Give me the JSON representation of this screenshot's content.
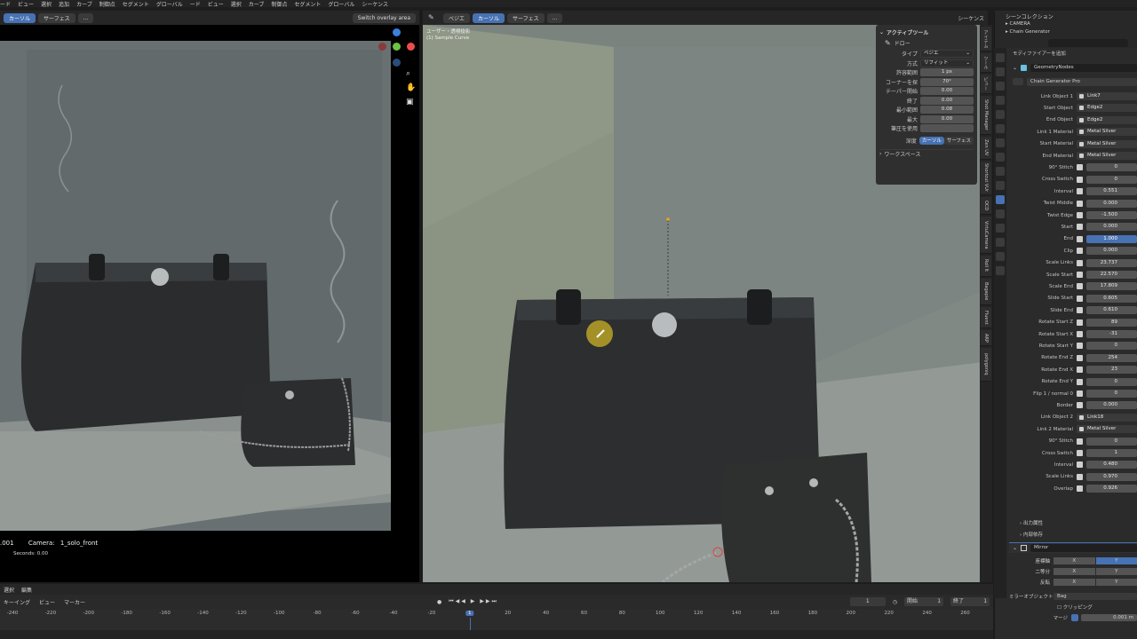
{
  "topbar": {
    "menus": [
      "ード",
      "ビュー",
      "選択",
      "追加",
      "カーブ",
      "制御点",
      "セグメント",
      "グローバル",
      "ード",
      "ビュー",
      "選択",
      "カーブ",
      "制御点",
      "セグメント",
      "グローバル",
      "シーケンス"
    ]
  },
  "left_header": {
    "mode_cursor": "カーソル",
    "mode_surface": "サーフェス",
    "more": "...",
    "overlay_button": "Switch overlay area"
  },
  "left_viewport": {
    "frame_text": ".001",
    "camera_label": "Camera:",
    "camera_name": "1_solo_front",
    "seconds": "Seconds: 0.00"
  },
  "right_header": {
    "curve_type": "ベジエ",
    "mode_cursor": "カーソル",
    "mode_surface": "サーフェス",
    "more": "...",
    "sequence": "シーケンス"
  },
  "right_viewport": {
    "view_name": "ユーザー・透視投影",
    "object_name": "(1) Sample Curve"
  },
  "tool_panel": {
    "title": "アクティブツール",
    "tool": "ドロー",
    "rows": [
      {
        "label": "タイプ",
        "value": "ベジエ",
        "kind": "drop"
      },
      {
        "label": "方式",
        "value": "リフィット",
        "kind": "drop"
      },
      {
        "label": "許容範囲",
        "value": "1 px",
        "kind": "val"
      },
      {
        "label": "コーナーを探",
        "value": "70°",
        "kind": "val"
      },
      {
        "label": "テーパー開始",
        "value": "0.00",
        "kind": "val"
      },
      {
        "label": "終了",
        "value": "0.00",
        "kind": "val"
      },
      {
        "label": "最小範囲",
        "value": "0.08",
        "kind": "val"
      },
      {
        "label": "最大",
        "value": "0.00",
        "kind": "val"
      },
      {
        "label": "筆圧を使用",
        "value": "",
        "kind": "val"
      }
    ],
    "depth_label": "深度",
    "depth_cursor": "カーソル",
    "depth_surface": "サーフェス",
    "workspace": "ワークスペース"
  },
  "vtabs": [
    "アイテム",
    "ツール",
    "ビュー",
    "Shot Manager",
    "Zen UV",
    "Shortcut VUr",
    "OCD",
    "VirtuCamera",
    "Roll It",
    "Bagapie",
    "Fluent",
    "ARP",
    "polygoniq"
  ],
  "outliner": {
    "title": "シーンコレクション",
    "items": [
      "CAMERA",
      "Chain Generator"
    ]
  },
  "properties": {
    "add_modifier": "モディファイアーを追加",
    "modifier_name": "GeometryNodes",
    "node_group": "Chain Generator Pro",
    "rows": [
      {
        "label": "Link Object 1",
        "value": "Link7",
        "kind": "obj"
      },
      {
        "label": "Start Object",
        "value": "Edge2",
        "kind": "obj"
      },
      {
        "label": "End Object",
        "value": "Edge2",
        "kind": "obj"
      },
      {
        "label": "Link 1 Material",
        "value": "Metal Silver",
        "kind": "obj"
      },
      {
        "label": "Start Material",
        "value": "Metal Silver",
        "kind": "obj"
      },
      {
        "label": "End Material",
        "value": "Metal Silver",
        "kind": "obj"
      },
      {
        "label": "90° Stitch",
        "value": "0",
        "kind": "val"
      },
      {
        "label": "Cross Switch",
        "value": "0",
        "kind": "val"
      },
      {
        "label": "Interval",
        "value": "0.551",
        "kind": "val"
      },
      {
        "label": "Twist Middle",
        "value": "0.000",
        "kind": "val"
      },
      {
        "label": "Twist Edge",
        "value": "-1.500",
        "kind": "val"
      },
      {
        "label": "Start",
        "value": "0.000",
        "kind": "val"
      },
      {
        "label": "End",
        "value": "1.000",
        "kind": "hl"
      },
      {
        "label": "Clip",
        "value": "0.000",
        "kind": "val"
      },
      {
        "label": "Scale Links",
        "value": "23.737",
        "kind": "val"
      },
      {
        "label": "Scale Start",
        "value": "22.570",
        "kind": "val"
      },
      {
        "label": "Scale End",
        "value": "17.809",
        "kind": "val"
      },
      {
        "label": "Slide Start",
        "value": "0.605",
        "kind": "val"
      },
      {
        "label": "Slide End",
        "value": "0.610",
        "kind": "val"
      },
      {
        "label": "Rotate Start Z",
        "value": "89",
        "kind": "val"
      },
      {
        "label": "Rotate Start X",
        "value": "-31",
        "kind": "val"
      },
      {
        "label": "Rotate Start Y",
        "value": "0",
        "kind": "val"
      },
      {
        "label": "Rotate End Z",
        "value": "254",
        "kind": "val"
      },
      {
        "label": "Rotate End X",
        "value": "23",
        "kind": "val"
      },
      {
        "label": "Rotate End Y",
        "value": "0",
        "kind": "val"
      },
      {
        "label": "Flip 1 / normal 0",
        "value": "0",
        "kind": "val"
      },
      {
        "label": "Border",
        "value": "0.000",
        "kind": "val"
      },
      {
        "label": "Link Object 2",
        "value": "Link18",
        "kind": "obj"
      },
      {
        "label": "Link 2 Material",
        "value": "Metal Silver",
        "kind": "obj"
      },
      {
        "label": "90° Stitch",
        "value": "0",
        "kind": "val"
      },
      {
        "label": "Cross Switch",
        "value": "1",
        "kind": "val"
      },
      {
        "label": "Interval",
        "value": "0.480",
        "kind": "val"
      },
      {
        "label": "Scale Links",
        "value": "0.970",
        "kind": "val"
      },
      {
        "label": "Overlap",
        "value": "0.926",
        "kind": "val"
      }
    ],
    "output_attrs": "出力属性",
    "internal_deps": "内部依存",
    "mirror": {
      "name": "Mirror",
      "axis_label": "座標軸",
      "bisect_label": "二等分",
      "flip_label": "反転",
      "x": "X",
      "y": "Y",
      "mirror_object_label": "ミラーオブジェクト",
      "mirror_object": "Bag",
      "clipping": "クリッピング",
      "merge_label": "マージ",
      "merge_value": "0.001 m"
    }
  },
  "timeline": {
    "header": [
      "選択",
      "編集"
    ],
    "bar_left": [
      "キーイング",
      "ビュー",
      "マーカー"
    ],
    "current_frame": "1",
    "start_label": "開始",
    "start_value": "1",
    "end_label": "終了",
    "end_value": "1",
    "ticks": [
      "-240",
      "-220",
      "-200",
      "-180",
      "-160",
      "-140",
      "-120",
      "-100",
      "-80",
      "-60",
      "-40",
      "-20",
      "1",
      "20",
      "40",
      "60",
      "80",
      "100",
      "120",
      "140",
      "160",
      "180",
      "200",
      "220",
      "240",
      "260"
    ]
  },
  "colors": {
    "accent": "#4772b3",
    "gizmo_x": "#e84d4d",
    "gizmo_y": "#6cc343",
    "gizmo_z": "#3c7fe0"
  }
}
